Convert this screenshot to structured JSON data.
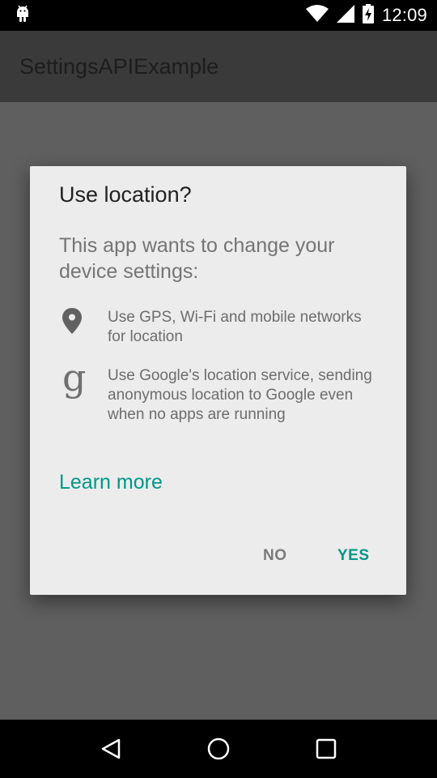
{
  "status_bar": {
    "time": "12:09",
    "icons": [
      "android-debug-icon",
      "wifi-icon",
      "signal-icon",
      "battery-charging-icon"
    ]
  },
  "app_bar": {
    "title": "SettingsAPIExample"
  },
  "dialog": {
    "title": "Use location?",
    "message": "This app wants to change your device settings:",
    "items": [
      {
        "icon": "location-pin-icon",
        "text": "Use GPS, Wi-Fi and mobile networks for location"
      },
      {
        "icon": "google-g-icon",
        "glyph": "g",
        "text": "Use Google's location service, sending anonymous location to Google even when no apps are running"
      }
    ],
    "learn_more": "Learn more",
    "buttons": {
      "negative": "NO",
      "positive": "YES"
    }
  },
  "nav_bar": {
    "buttons": [
      "back-icon",
      "home-icon",
      "recents-icon"
    ]
  },
  "colors": {
    "accent": "#00968A",
    "dialog_bg": "#ECECEC",
    "scrim": "#5F5F5F",
    "app_bar": "#3A3A3A"
  }
}
